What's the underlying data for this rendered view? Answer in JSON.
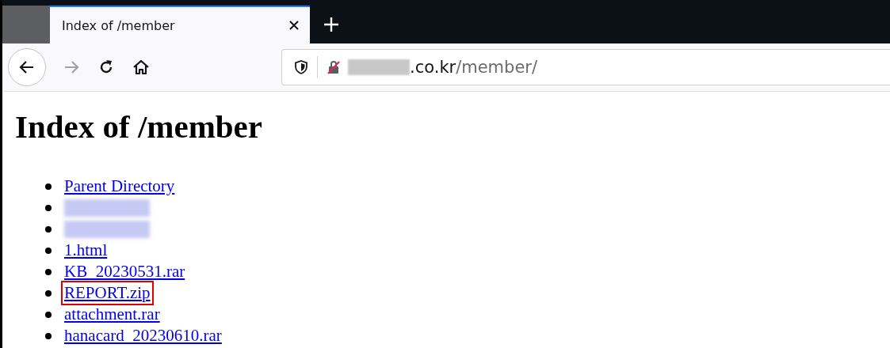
{
  "tab": {
    "title": "Index of /member",
    "selected": true
  },
  "address": {
    "host_blurred": true,
    "host_suffix": ".co.kr",
    "path": "/member/"
  },
  "page": {
    "heading": "Index of /member",
    "items": [
      {
        "kind": "link",
        "text": "Parent Directory",
        "highlighted": false
      },
      {
        "kind": "blurred"
      },
      {
        "kind": "blurred"
      },
      {
        "kind": "link",
        "text": "1.html",
        "highlighted": false
      },
      {
        "kind": "link",
        "text": "KB_20230531.rar",
        "highlighted": false
      },
      {
        "kind": "link",
        "text": "REPORT.zip",
        "highlighted": true
      },
      {
        "kind": "link",
        "text": "attachment.rar",
        "highlighted": false
      },
      {
        "kind": "link",
        "text": "hanacard_20230610.rar",
        "highlighted": false
      }
    ]
  }
}
